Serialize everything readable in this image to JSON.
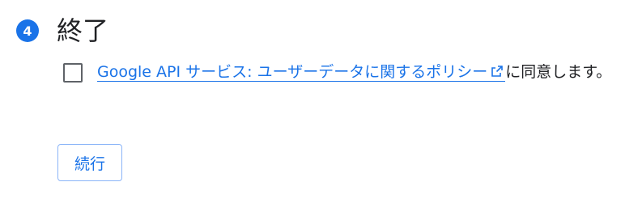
{
  "step": {
    "number": "4",
    "title": "終了"
  },
  "consent": {
    "checked": false,
    "link_text": "Google API サービス: ユーザーデータに関するポリシー",
    "suffix_text": "に同意します。",
    "link_icon": "external-link-icon"
  },
  "actions": {
    "continue_label": "続行"
  },
  "colors": {
    "accent": "#1a73e8",
    "text": "#202124",
    "checkbox_border": "#5f6368"
  }
}
